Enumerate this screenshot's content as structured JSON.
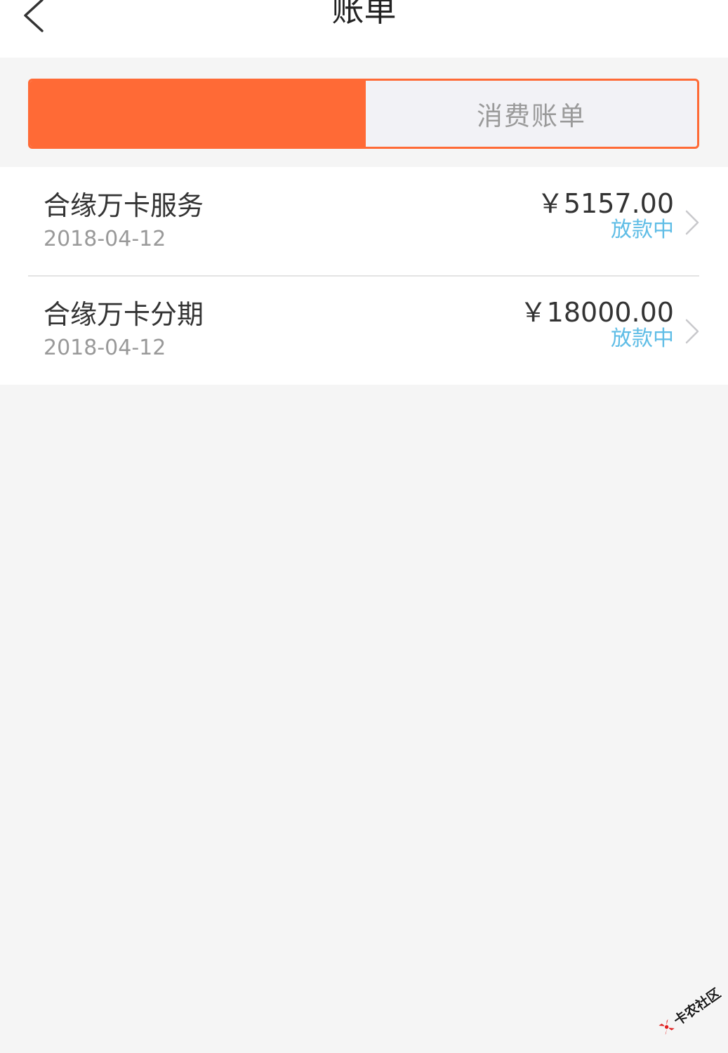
{
  "header": {
    "title": "账单",
    "back_icon": "chevron-left-icon"
  },
  "tabs": [
    {
      "active": true
    },
    {
      "label": "消费账单",
      "active": false
    }
  ],
  "bills": [
    {
      "name": "合缘万卡服务",
      "date": "2018-04-12",
      "amount": "￥5157.00",
      "status": "放款中",
      "icon": "chevron-right-icon"
    },
    {
      "name": "合缘万卡分期",
      "date": "2018-04-12",
      "amount": "￥18000.00",
      "status": "放款中",
      "icon": "chevron-right-icon"
    }
  ],
  "watermark": {
    "text": "卡农社区",
    "icon": "kanong-logo-icon"
  },
  "colors": {
    "accent": "#FF6A36",
    "status": "#5FBDE6",
    "text": "#333333",
    "muted": "#999999",
    "bg": "#F5F5F5",
    "divider": "#E3E3E3"
  }
}
